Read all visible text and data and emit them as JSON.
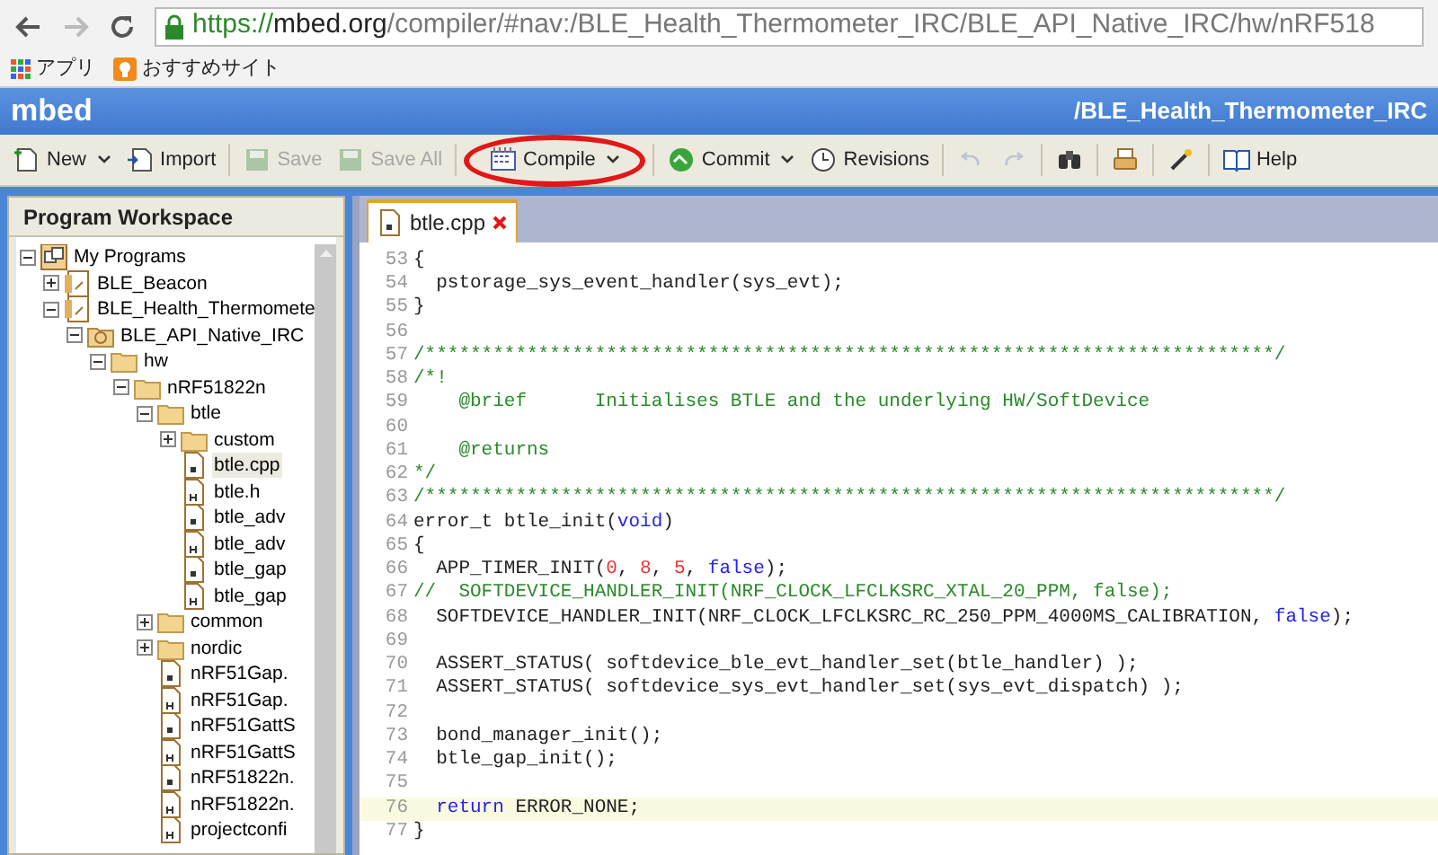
{
  "browser": {
    "url": {
      "scheme": "https://",
      "host": "mbed.org",
      "path": "/compiler/#nav:/BLE_Health_Thermometer_IRC/BLE_API_Native_IRC/hw/nRF518"
    },
    "bookmarks": [
      {
        "kind": "apps",
        "label": "アプリ"
      },
      {
        "kind": "site",
        "label": "おすすめサイト"
      }
    ]
  },
  "header": {
    "logo": "mbed",
    "path": "/BLE_Health_Thermometer_IRC"
  },
  "toolbar": [
    {
      "kind": "new",
      "label": "New",
      "dropdown": true,
      "disabled": false,
      "highlighted": false
    },
    {
      "kind": "import",
      "label": "Import",
      "dropdown": false,
      "disabled": false,
      "highlighted": false
    },
    {
      "kind": "save",
      "label": "Save",
      "dropdown": false,
      "disabled": true,
      "highlighted": false
    },
    {
      "kind": "saveall",
      "label": "Save All",
      "dropdown": false,
      "disabled": true,
      "highlighted": false
    },
    {
      "kind": "compile",
      "label": "Compile",
      "dropdown": true,
      "disabled": false,
      "highlighted": true
    },
    {
      "kind": "commit",
      "label": "Commit",
      "dropdown": true,
      "disabled": false,
      "highlighted": false
    },
    {
      "kind": "revisions",
      "label": "Revisions",
      "dropdown": false,
      "disabled": false,
      "highlighted": false
    },
    {
      "kind": "undo",
      "dropdown": false,
      "disabled": true,
      "highlighted": false
    },
    {
      "kind": "redo",
      "dropdown": false,
      "disabled": true,
      "highlighted": false
    },
    {
      "kind": "find",
      "dropdown": false,
      "disabled": false,
      "highlighted": false
    },
    {
      "kind": "print",
      "dropdown": false,
      "disabled": false,
      "highlighted": false
    },
    {
      "kind": "wand",
      "dropdown": false,
      "disabled": false,
      "highlighted": false
    },
    {
      "kind": "help",
      "label": "Help",
      "dropdown": false,
      "disabled": false,
      "highlighted": false
    }
  ],
  "sidebar": {
    "title": "Program Workspace",
    "tree": [
      {
        "kind": "workspace",
        "label": "My Programs",
        "expanded": true,
        "selected": false,
        "children": [
          {
            "kind": "program",
            "label": "BLE_Beacon",
            "expanded": false,
            "selected": false
          },
          {
            "kind": "program",
            "label": "BLE_Health_Thermomete",
            "expanded": true,
            "selected": false,
            "children": [
              {
                "kind": "library",
                "label": "BLE_API_Native_IRC",
                "expanded": true,
                "selected": false,
                "children": [
                  {
                    "kind": "folder",
                    "label": "hw",
                    "expanded": true,
                    "selected": false,
                    "children": [
                      {
                        "kind": "folder",
                        "label": "nRF51822n",
                        "expanded": true,
                        "selected": false,
                        "children": [
                          {
                            "kind": "folder",
                            "label": "btle",
                            "expanded": true,
                            "selected": false,
                            "children": [
                              {
                                "kind": "folder",
                                "label": "custom",
                                "expanded": false,
                                "selected": false
                              },
                              {
                                "kind": "file-c",
                                "label": "btle.cpp",
                                "selected": true
                              },
                              {
                                "kind": "file-h",
                                "label": "btle.h",
                                "selected": false
                              },
                              {
                                "kind": "file-c",
                                "label": "btle_adv",
                                "selected": false
                              },
                              {
                                "kind": "file-h",
                                "label": "btle_adv",
                                "selected": false
                              },
                              {
                                "kind": "file-c",
                                "label": "btle_gap",
                                "selected": false
                              },
                              {
                                "kind": "file-h",
                                "label": "btle_gap",
                                "selected": false
                              }
                            ]
                          },
                          {
                            "kind": "folder",
                            "label": "common",
                            "expanded": false,
                            "selected": false
                          },
                          {
                            "kind": "folder",
                            "label": "nordic",
                            "expanded": false,
                            "selected": false
                          },
                          {
                            "kind": "file-c",
                            "label": "nRF51Gap.",
                            "selected": false
                          },
                          {
                            "kind": "file-h",
                            "label": "nRF51Gap.",
                            "selected": false
                          },
                          {
                            "kind": "file-c",
                            "label": "nRF51GattS",
                            "selected": false
                          },
                          {
                            "kind": "file-h",
                            "label": "nRF51GattS",
                            "selected": false
                          },
                          {
                            "kind": "file-c",
                            "label": "nRF51822n.",
                            "selected": false
                          },
                          {
                            "kind": "file-h",
                            "label": "nRF51822n.",
                            "selected": false
                          },
                          {
                            "kind": "file-h",
                            "label": "projectconfi",
                            "selected": false
                          }
                        ]
                      }
                    ]
                  }
                ]
              }
            ]
          }
        ]
      }
    ]
  },
  "editor": {
    "tabs": [
      {
        "label": "btle.cpp",
        "selected": true,
        "closable": true
      }
    ],
    "lines": [
      {
        "number": "53",
        "current": false,
        "segments": [
          {
            "kind": "plain",
            "text": "{"
          }
        ]
      },
      {
        "number": "54",
        "current": false,
        "segments": [
          {
            "kind": "plain",
            "text": "  pstorage_sys_event_handler(sys_evt);"
          }
        ]
      },
      {
        "number": "55",
        "current": false,
        "segments": [
          {
            "kind": "plain",
            "text": "}"
          }
        ]
      },
      {
        "number": "56",
        "current": false
      },
      {
        "number": "57",
        "current": false,
        "segments": [
          {
            "kind": "comment",
            "text": "/***************************************************************************/"
          }
        ]
      },
      {
        "number": "58",
        "current": false,
        "segments": [
          {
            "kind": "comment",
            "text": "/*!"
          }
        ]
      },
      {
        "number": "59",
        "current": false,
        "segments": [
          {
            "kind": "comment",
            "text": "    @brief      Initialises BTLE and the underlying HW/SoftDevice"
          }
        ]
      },
      {
        "number": "60",
        "current": false
      },
      {
        "number": "61",
        "current": false,
        "segments": [
          {
            "kind": "comment",
            "text": "    @returns"
          }
        ]
      },
      {
        "number": "62",
        "current": false,
        "segments": [
          {
            "kind": "comment",
            "text": "*/"
          }
        ]
      },
      {
        "number": "63",
        "current": false,
        "segments": [
          {
            "kind": "comment",
            "text": "/***************************************************************************/"
          }
        ]
      },
      {
        "number": "64",
        "current": false,
        "segments": [
          {
            "kind": "plain",
            "text": "error_t btle_init("
          },
          {
            "kind": "keyword",
            "text": "void"
          },
          {
            "kind": "plain",
            "text": ")"
          }
        ]
      },
      {
        "number": "65",
        "current": false,
        "segments": [
          {
            "kind": "plain",
            "text": "{"
          }
        ]
      },
      {
        "number": "66",
        "current": false,
        "segments": [
          {
            "kind": "plain",
            "text": "  APP_TIMER_INIT("
          },
          {
            "kind": "number",
            "text": "0"
          },
          {
            "kind": "plain",
            "text": ", "
          },
          {
            "kind": "number",
            "text": "8"
          },
          {
            "kind": "plain",
            "text": ", "
          },
          {
            "kind": "number",
            "text": "5"
          },
          {
            "kind": "plain",
            "text": ", "
          },
          {
            "kind": "keyword",
            "text": "false"
          },
          {
            "kind": "plain",
            "text": ");"
          }
        ]
      },
      {
        "number": "67",
        "current": false,
        "segments": [
          {
            "kind": "comment",
            "text": "//  SOFTDEVICE_HANDLER_INIT(NRF_CLOCK_LFCLKSRC_XTAL_20_PPM, false);"
          }
        ]
      },
      {
        "number": "68",
        "current": false,
        "segments": [
          {
            "kind": "plain",
            "text": "  SOFTDEVICE_HANDLER_INIT(NRF_CLOCK_LFCLKSRC_RC_250_PPM_4000MS_CALIBRATION, "
          },
          {
            "kind": "keyword",
            "text": "false"
          },
          {
            "kind": "plain",
            "text": ");"
          }
        ]
      },
      {
        "number": "69",
        "current": false
      },
      {
        "number": "70",
        "current": false,
        "segments": [
          {
            "kind": "plain",
            "text": "  ASSERT_STATUS( softdevice_ble_evt_handler_set(btle_handler) );"
          }
        ]
      },
      {
        "number": "71",
        "current": false,
        "segments": [
          {
            "kind": "plain",
            "text": "  ASSERT_STATUS( softdevice_sys_evt_handler_set(sys_evt_dispatch) );"
          }
        ]
      },
      {
        "number": "72",
        "current": false
      },
      {
        "number": "73",
        "current": false,
        "segments": [
          {
            "kind": "plain",
            "text": "  bond_manager_init();"
          }
        ]
      },
      {
        "number": "74",
        "current": false,
        "segments": [
          {
            "kind": "plain",
            "text": "  btle_gap_init();"
          }
        ]
      },
      {
        "number": "75",
        "current": false
      },
      {
        "number": "76",
        "current": true,
        "segments": [
          {
            "kind": "keyword",
            "text": "  return"
          },
          {
            "kind": "plain",
            "text": " ERROR_NONE;"
          }
        ]
      },
      {
        "number": "77",
        "current": false,
        "segments": [
          {
            "kind": "plain",
            "text": "}"
          }
        ]
      }
    ]
  }
}
